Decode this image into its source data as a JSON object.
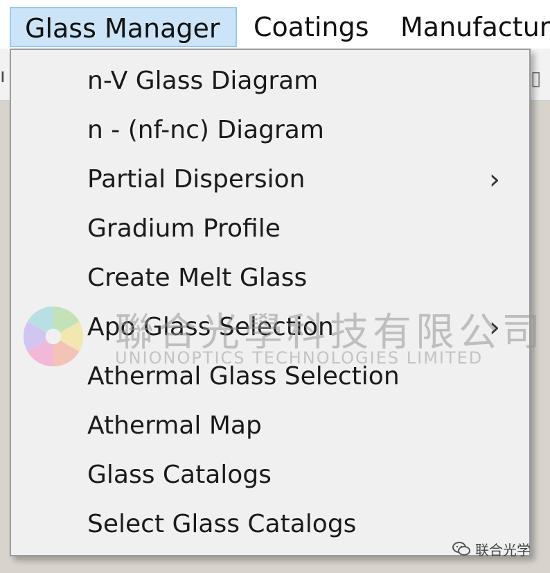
{
  "menubar": {
    "items": [
      {
        "label": "Glass Manager"
      },
      {
        "label": "Coatings"
      },
      {
        "label": "Manufacturi"
      }
    ]
  },
  "dropdown": {
    "items": [
      {
        "label": "n-V Glass Diagram",
        "has_submenu": false
      },
      {
        "label": "n - (nf-nc)  Diagram",
        "has_submenu": false
      },
      {
        "label": "Partial Dispersion",
        "has_submenu": true
      },
      {
        "label": "Gradium Profile",
        "has_submenu": false
      },
      {
        "label": "Create Melt Glass",
        "has_submenu": false
      },
      {
        "label": "Apo Glass Selection",
        "has_submenu": true
      },
      {
        "label": "Athermal Glass Selection",
        "has_submenu": false
      },
      {
        "label": "Athermal Map",
        "has_submenu": false
      },
      {
        "label": "Glass Catalogs",
        "has_submenu": false
      },
      {
        "label": "Select Glass Catalogs",
        "has_submenu": false
      }
    ],
    "submenu_chevron": "›"
  },
  "watermark": {
    "chinese": "聯合光學科技有限公司",
    "english": "UNIONOPTICS TECHNOLOGIES LIMITED",
    "bottom_label": "联合光学"
  },
  "colors": {
    "menubar_bg": "#ffffff",
    "active_menu_bg": "#cce4f7",
    "active_menu_border": "#99c9ef",
    "dropdown_bg": "#f0f0f0",
    "dropdown_border": "#9a9a9a",
    "text": "#1a1a1a"
  }
}
